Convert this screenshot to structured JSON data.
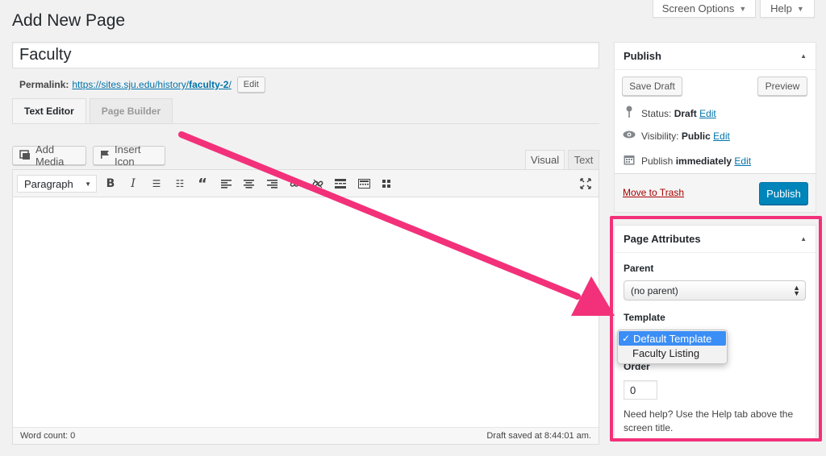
{
  "header": {
    "screen_options": "Screen Options",
    "help": "Help",
    "page_title": "Add New Page"
  },
  "post": {
    "title_value": "Faculty",
    "permalink_label": "Permalink:",
    "permalink_base": "https://sites.sju.edu/history/",
    "permalink_slug": "faculty-2",
    "permalink_trail": "/",
    "edit_label": "Edit"
  },
  "editor": {
    "tabs": [
      "Text Editor",
      "Page Builder"
    ],
    "add_media": "Add Media",
    "insert_icon": "Insert Icon",
    "mode_visual": "Visual",
    "mode_text": "Text",
    "format_value": "Paragraph",
    "word_count": "Word count: 0",
    "draft_saved": "Draft saved at 8:44:01 am."
  },
  "publish": {
    "heading": "Publish",
    "save_draft": "Save Draft",
    "preview": "Preview",
    "status_label": "Status:",
    "status_value": "Draft",
    "visibility_label": "Visibility:",
    "visibility_value": "Public",
    "publish_label": "Publish",
    "publish_value": "immediately",
    "edit_link": "Edit",
    "move_to_trash": "Move to Trash",
    "publish_button": "Publish"
  },
  "attributes": {
    "heading": "Page Attributes",
    "parent_label": "Parent",
    "parent_value": "(no parent)",
    "template_label": "Template",
    "template_options": [
      "Default Template",
      "Faculty Listing"
    ],
    "order_label": "Order",
    "order_value": "0",
    "help_text": "Need help? Use the Help tab above the screen title."
  },
  "colors": {
    "accent": "#0085ba",
    "highlight": "#f2317a",
    "link": "#0073aa"
  }
}
